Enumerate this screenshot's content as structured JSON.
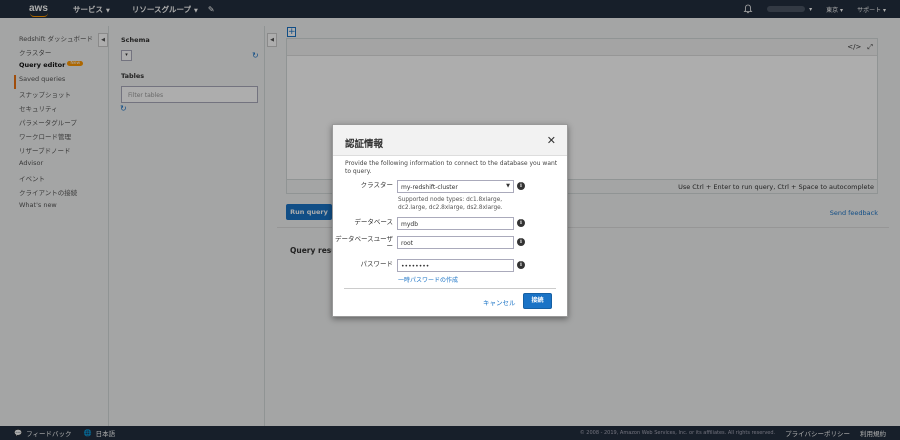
{
  "header": {
    "logo": "aws",
    "services": "サービス",
    "resource_groups": "リソースグループ",
    "pin_icon": "pin-icon",
    "region": "東京",
    "support": "サポート"
  },
  "sidebar": {
    "items": [
      {
        "label": "Redshift ダッシュボード"
      },
      {
        "label": "クラスター"
      },
      {
        "label": "Query editor",
        "badge": "New",
        "active": true
      },
      {
        "label": "Saved queries"
      },
      {
        "label": "スナップショット"
      },
      {
        "label": "セキュリティ"
      },
      {
        "label": "パラメータグループ"
      },
      {
        "label": "ワークロード管理"
      },
      {
        "label": "リザーブドノード"
      },
      {
        "label": "Advisor"
      },
      {
        "label": "イベント"
      },
      {
        "label": "クライアントの接続"
      },
      {
        "label": "What's new"
      }
    ]
  },
  "schema_panel": {
    "schema_title": "Schema",
    "tables_title": "Tables",
    "filter_placeholder": "Filter tables"
  },
  "editor": {
    "hint": "Use Ctrl + Enter to run query, Ctrl + Space to autocomplete",
    "run_button": "Run query",
    "send_feedback": "Send feedback",
    "results_title": "Query results"
  },
  "modal": {
    "title": "認証情報",
    "description": "Provide the following information to connect to the database you want to query.",
    "cluster_label": "クラスター",
    "cluster_value": "my-redshift-cluster",
    "cluster_hint": "Supported node types: dc1.8xlarge, dc2.large, dc2.8xlarge, ds2.8xlarge.",
    "database_label": "データベース",
    "database_value": "mydb",
    "db_user_label": "データベースユーザー",
    "db_user_value": "root",
    "password_label": "パスワード",
    "password_value": "••••••••",
    "temp_password_link": "一時パスワードの作成",
    "cancel": "キャンセル",
    "connect": "接続"
  },
  "footer": {
    "feedback": "フィードバック",
    "language": "日本語",
    "copyright": "© 2008 - 2019, Amazon Web Services, Inc. or its affiliates. All rights reserved.",
    "privacy": "プライバシーポリシー",
    "terms": "利用規約"
  },
  "colors": {
    "nav_bg": "#232f3e",
    "accent": "#ec7211",
    "primary": "#1a73c6"
  }
}
